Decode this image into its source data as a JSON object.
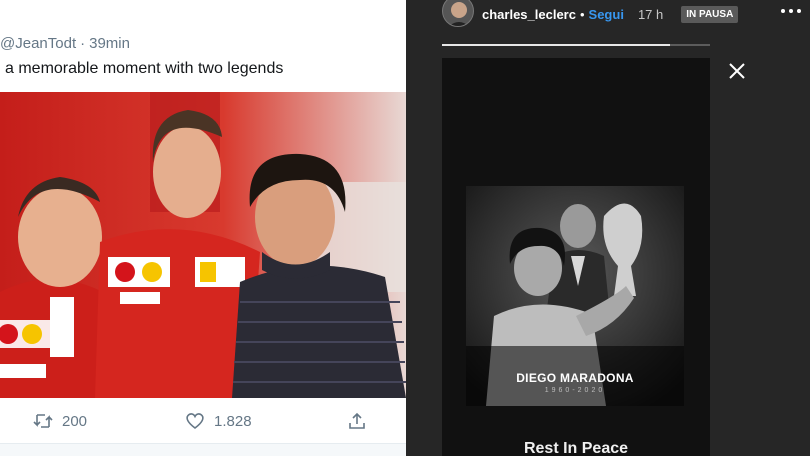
{
  "tweet": {
    "handle": "@JeanTodt",
    "separator": "·",
    "time": "39min",
    "text": "a memorable moment with two legends",
    "photo_icon": "photo-three-men",
    "actions": {
      "retweet_icon": "retweet-icon",
      "retweet_count": "200",
      "like_icon": "heart-icon",
      "like_count": "1.828",
      "share_icon": "share-icon"
    }
  },
  "story": {
    "username": "charles_leclerc",
    "separator": "•",
    "follow_label": "Segui",
    "time": "17 h",
    "status_badge": "IN PAUSA",
    "progress": 0.85,
    "image_icon": "tribute-photo",
    "tribute_name": "DIEGO MARADONA",
    "tribute_years": "1960-2020",
    "caption": "Rest In Peace",
    "colors": {
      "follow": "#3897f0",
      "background": "#262626"
    }
  }
}
